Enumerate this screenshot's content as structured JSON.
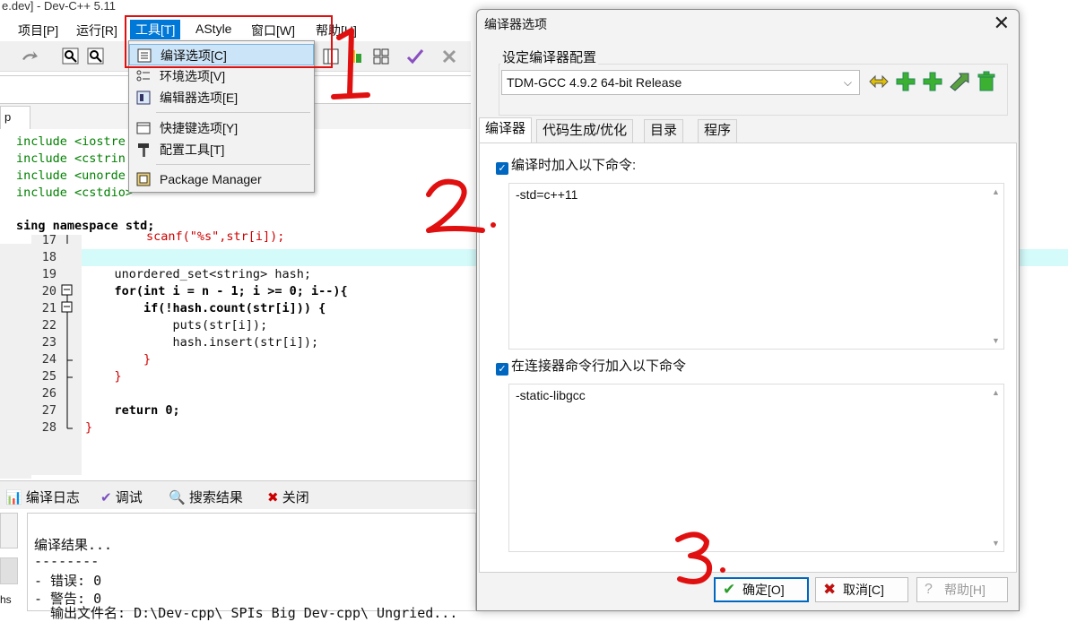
{
  "ide": {
    "title": "e.dev] - Dev-C++ 5.11",
    "menu": [
      "项目[P]",
      "运行[R]",
      "工具[T]",
      "AStyle",
      "窗口[W]",
      "帮助[H]"
    ],
    "code_top": [
      "include <iostre",
      "include <cstrin",
      "include <unorde",
      "include <cstdio>",
      "sing namespace std;"
    ],
    "scanf_line": "scanf(\"%s\",str[i]);",
    "line_numbers": [
      "17",
      "18",
      "19",
      "20",
      "21",
      "22",
      "23",
      "24",
      "25",
      "26",
      "27",
      "28"
    ],
    "code_lines": [
      "",
      "",
      "    unordered_set<string> hash;",
      "    for(int i = n - 1; i >= 0; i--){",
      "        if(!hash.count(str[i])) {",
      "            puts(str[i]);",
      "            hash.insert(str[i]);",
      "        }",
      "    }",
      "",
      "    return 0;",
      "}"
    ],
    "tab_partial": "p",
    "bottom_tabs": [
      "编译日志",
      "调试",
      "搜索结果",
      "关闭"
    ],
    "log_lines": [
      "编译结果...",
      "--------",
      "- 错误: 0",
      "- 警告: 0",
      "  输出文件名: D:\\Dev-cpp\\ SPIs Big Dev-cpp\\ Ungried..."
    ],
    "left_stub": "hs"
  },
  "tools_menu": {
    "items": [
      "编译选项[C]",
      "环境选项[V]",
      "编辑器选项[E]",
      "快捷键选项[Y]",
      "配置工具[T]",
      "Package Manager"
    ]
  },
  "dialog": {
    "title": "编译器选项",
    "group_label": "设定编译器配置",
    "compiler_select": "TDM-GCC 4.9.2 64-bit Release",
    "tabs": [
      "编译器",
      "代码生成/优化",
      "目录",
      "程序"
    ],
    "check1_label": "编译时加入以下命令:",
    "check1_value": "-std=c++11",
    "check2_label": "在连接器命令行加入以下命令",
    "check2_value": "-static-libgcc",
    "buttons": {
      "ok": "确定[O]",
      "cancel": "取消[C]",
      "help": "帮助[H]"
    }
  },
  "annotations": [
    "1",
    "2.",
    "3."
  ],
  "colors": {
    "accent": "#0067c0",
    "annotation_red": "#e01010",
    "highlight_line": "#d4fafa"
  }
}
